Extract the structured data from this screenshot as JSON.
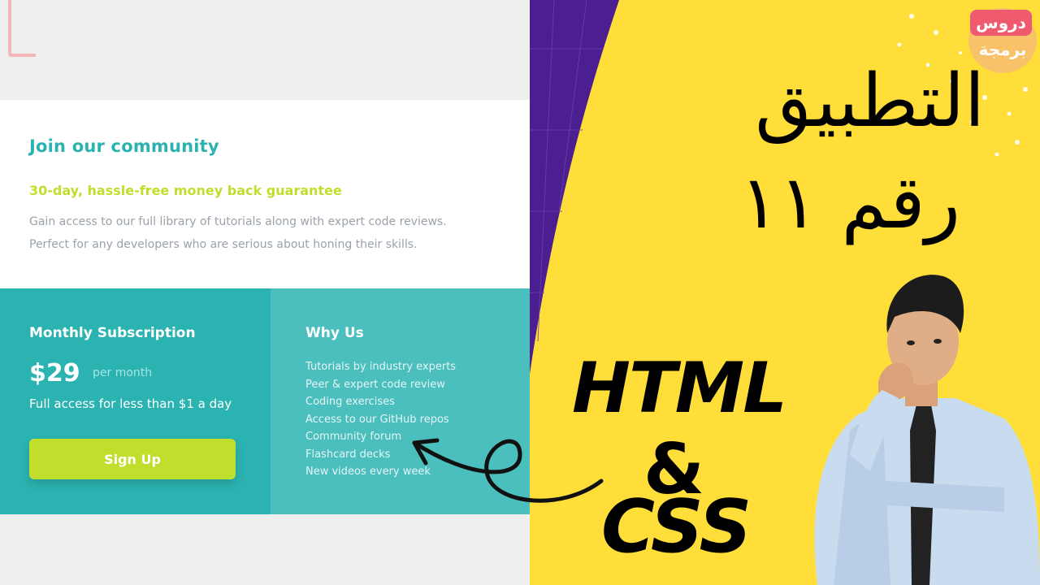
{
  "community": {
    "title": "Join our community",
    "guarantee": "30-day, hassle-free money back guarantee",
    "description_line1": "Gain access to our full library of tutorials along with expert code reviews.",
    "description_line2": "Perfect for any developers who are serious about honing their skills."
  },
  "subscription": {
    "title": "Monthly Subscription",
    "price": "$29",
    "period": "per month",
    "note": "Full access for less than $1 a day",
    "button_label": "Sign Up"
  },
  "why_us": {
    "title": "Why Us",
    "items": [
      "Tutorials by industry experts",
      "Peer & expert code review",
      "Coding exercises",
      "Access to our GitHub repos",
      "Community forum",
      "Flashcard decks",
      "New videos every week"
    ]
  },
  "promo": {
    "heading": "التطبيق",
    "number_label": "رقم ١١",
    "html_word": "HTML",
    "amp": "&",
    "css_word": "CSS",
    "badge_top": "دروس",
    "badge_bottom": "برمجة"
  },
  "colors": {
    "teal": "#2bb3b1",
    "teal_light": "#4bbfbd",
    "lime": "#bfdf2c",
    "yellow": "#ffde3a",
    "purple": "#4b1f8f"
  }
}
